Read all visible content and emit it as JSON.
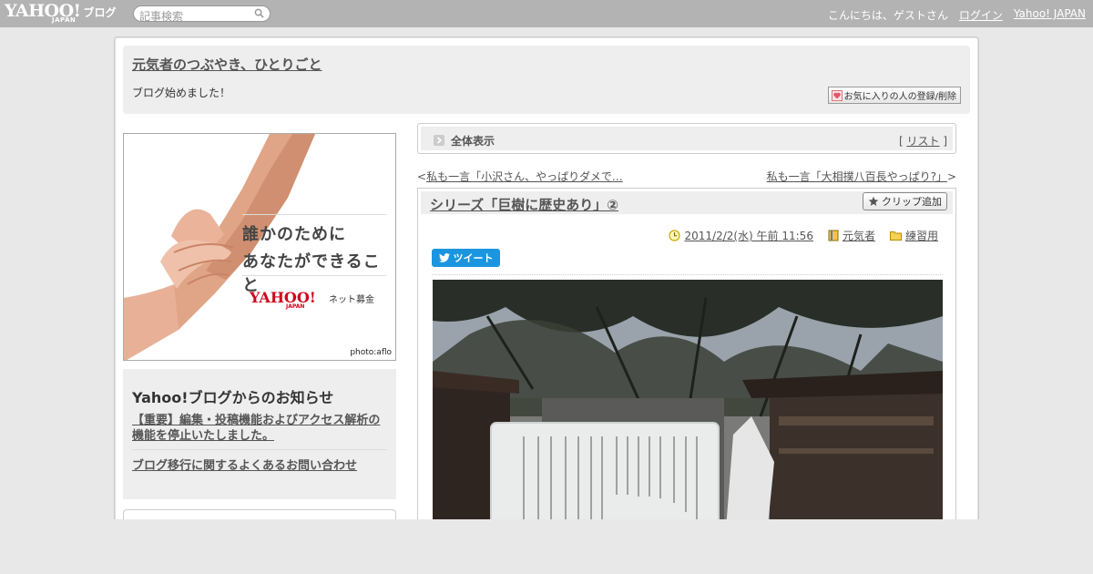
{
  "topbar": {
    "logo": "YAHOO!",
    "logo_sub": "JAPAN",
    "logo_blog": "ブログ",
    "search_placeholder": "記事検索",
    "greeting": "こんにちは、ゲストさん",
    "login": "ログイン",
    "yahoo_japan": "Yahoo! JAPAN"
  },
  "header": {
    "blog_title": "元気者のつぶやき、ひとりごと",
    "description": "ブログ始めました！",
    "favorite_button": "お気に入りの人の登録/削除"
  },
  "ad": {
    "line1": "誰かのために",
    "line2": "あなたができること",
    "logo": "YAHOO!",
    "logo_sub": "JAPAN",
    "donate": "ネット募金",
    "credit": "photo:aflo"
  },
  "notice": {
    "title": "Yahoo!ブログからのお知らせ",
    "link1": "【重要】編集・投稿機能およびアクセス解析の機能を停止いたしました。",
    "link2": "ブログ移行に関するよくあるお問い合わせ"
  },
  "nav": {
    "label": "全体表示",
    "list_open": "[",
    "list_label": "リスト",
    "list_close": "]"
  },
  "pager": {
    "prev_mark": "<",
    "prev_label": "私も一言「小沢さん、やっぱりダメで…",
    "next_label": "私も一言「大相撲八百長やっぱり?」",
    "next_mark": ">"
  },
  "entry": {
    "title": "シリーズ「巨樹に歴史あり」②",
    "clip_button": "クリップ追加",
    "datetime": "2011/2/2(水) 午前 11:56",
    "author": "元気者",
    "category": "練習用",
    "tweet": "ツイート"
  },
  "colors": {
    "topbar": "#b3b3b3",
    "panel": "#eeeeee",
    "twitter": "#1b95e0",
    "yahoo_red": "#d0021b"
  }
}
